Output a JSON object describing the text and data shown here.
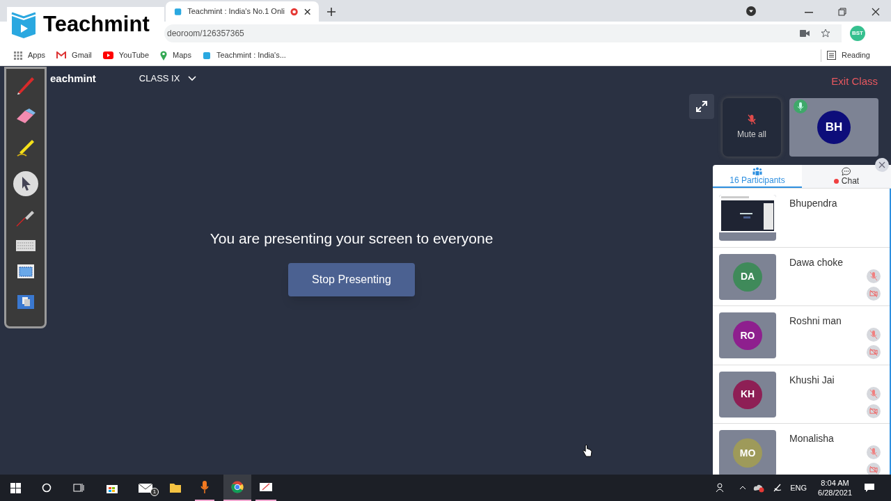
{
  "browser": {
    "tab_title": "Teachmint : India's No.1 Onli",
    "url": "deoroom/126357365",
    "profile": "BST",
    "bookmarks": [
      "Apps",
      "Gmail",
      "YouTube",
      "Maps",
      "Teachmint : India's..."
    ],
    "reading_list": "Reading"
  },
  "overlay_logo": "Teachmint",
  "app": {
    "logo": "eachmint",
    "class_selector": "CLASS IX",
    "exit": "Exit Class",
    "message": "You are presenting your screen to everyone",
    "stop_button": "Stop Presenting",
    "mute_all": "Mute all",
    "speaker": {
      "initials": "BH",
      "color": "#0d0d7a",
      "mic_on": true
    },
    "tabs": [
      {
        "label": "16 Participants",
        "selected": true,
        "unread": false
      },
      {
        "label": "Chat",
        "selected": false,
        "unread": true
      }
    ],
    "participants": [
      {
        "kind": "screen",
        "name": "Bhupendra",
        "muted": false
      },
      {
        "kind": "avatar",
        "name": "Dawa choke",
        "initials": "DA",
        "color": "#3f8a5a",
        "muted": true
      },
      {
        "kind": "avatar",
        "name": "Roshni man",
        "initials": "RO",
        "color": "#8e1f8e",
        "muted": true
      },
      {
        "kind": "avatar",
        "name": "Khushi Jai",
        "initials": "KH",
        "color": "#8e1f55",
        "muted": true
      },
      {
        "kind": "avatar",
        "name": "Monalisha",
        "initials": "MO",
        "color": "#9e9a5a",
        "muted": true
      }
    ]
  },
  "taskbar": {
    "language": "ENG",
    "time": "8:04 AM",
    "date": "6/28/2021",
    "mail_badge": "1"
  }
}
